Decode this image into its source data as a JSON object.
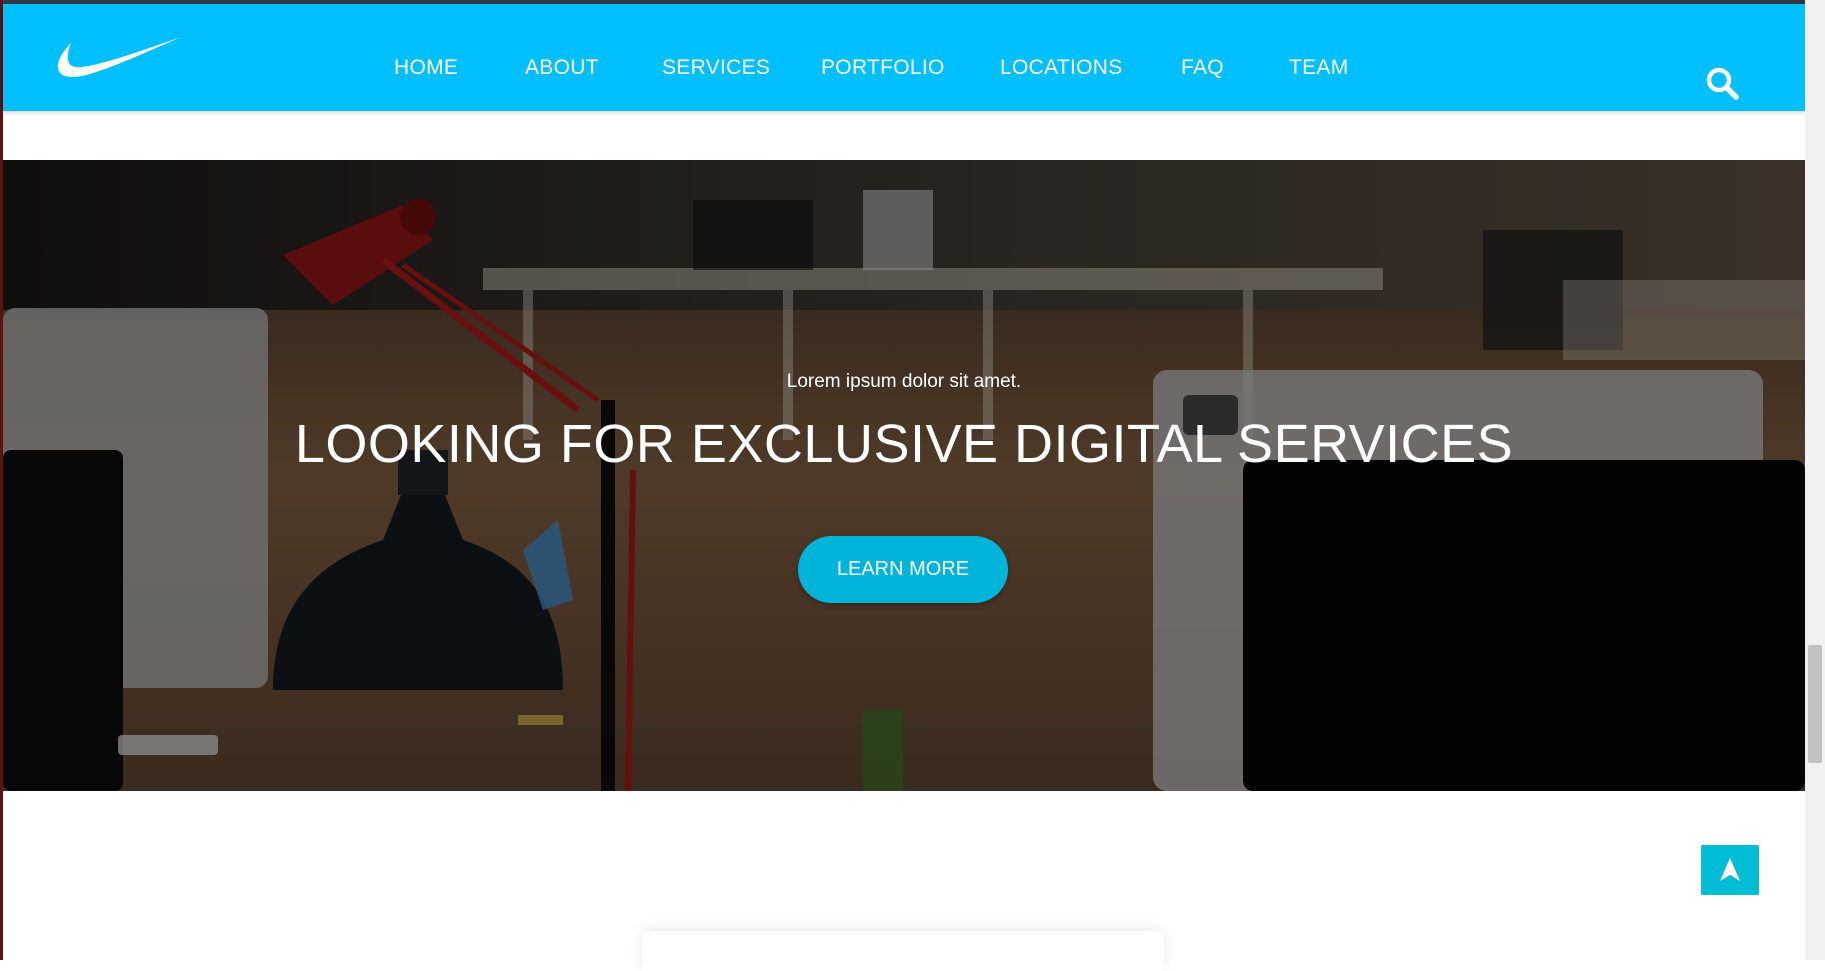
{
  "navbar": {
    "logo": "swoosh-logo",
    "links": [
      "HOME",
      "ABOUT",
      "SERVICES",
      "PORTFOLIO",
      "LOCATIONS",
      "FAQ",
      "TEAM"
    ],
    "search_icon": "search-icon"
  },
  "hero": {
    "subtitle": "Lorem ipsum dolor sit amet.",
    "title": "LOOKING FOR EXCLUSIVE DIGITAL SERVICES",
    "button_label": "LEARN MORE"
  },
  "back_to_top": {
    "icon": "arrow-up-icon"
  },
  "colors": {
    "navbar": "#00bfff",
    "button": "#00b3d9",
    "back_to_top": "#00bcd4",
    "text_on_dark": "#ffffff"
  }
}
